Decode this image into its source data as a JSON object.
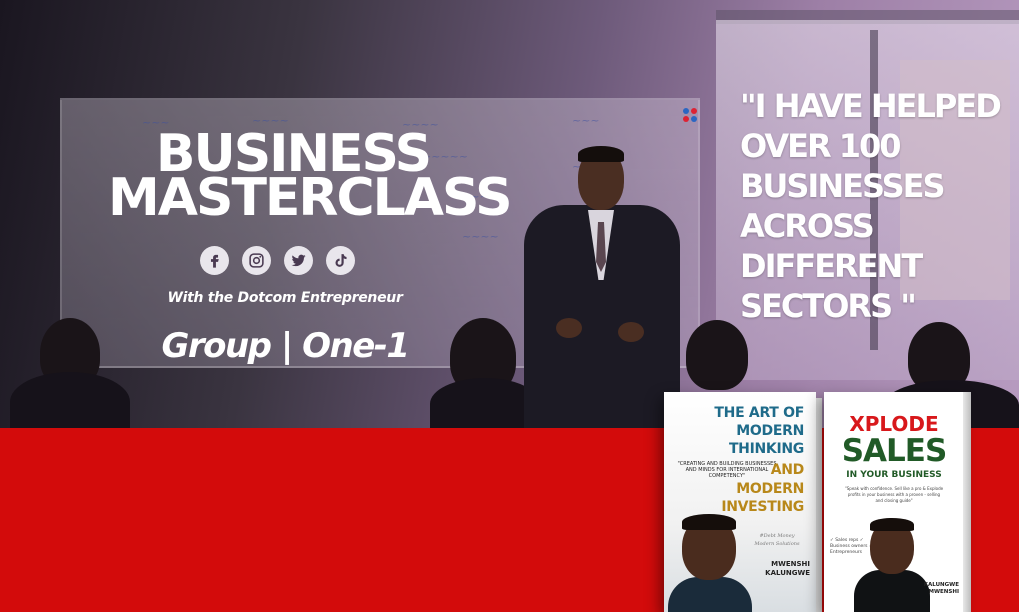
{
  "title": {
    "line1": "BUSINESS",
    "line2": "MASTERCLASS"
  },
  "socials": [
    {
      "icon": "facebook-icon"
    },
    {
      "icon": "instagram-icon"
    },
    {
      "icon": "twitter-icon"
    },
    {
      "icon": "tiktok-icon"
    }
  ],
  "subtitle": "With the Dotcom Entrepreneur",
  "group": "Group | One-1",
  "quote": "\"I HAVE HELPED OVER 100 BUSINESSES ACROSS DIFFERENT SECTORS \"",
  "colors": {
    "band": "#d30b0b",
    "text": "#ffffff",
    "book1_blue": "#1f6b8a",
    "book1_gold": "#b8881a",
    "book2_red": "#d8181b",
    "book2_green": "#215a27"
  },
  "book1": {
    "title_top": "THE ART OF MODERN THINKING",
    "and": "AND",
    "title_bottom": "MODERN INVESTING",
    "tagline": "\"CREATING AND BUILDING BUSINESSES AND MINDS FOR INTERNATIONAL COMPETENCY\"",
    "script": "#Debt Money Modern Solutions",
    "author": "MWENSHI KALUNGWE"
  },
  "book2": {
    "xplode": "XPLODE",
    "sales": "SALES",
    "sub": "IN YOUR BUSINESS",
    "desc": "\"Speak with confidence. Sell like a pro & Explode profits in your business with a proven - selling and closing guide\"",
    "list": "✓ Sales reps ✓ Business owners ✓ Entrepreneurs",
    "author": "KALUNGWE MWENSHI"
  }
}
